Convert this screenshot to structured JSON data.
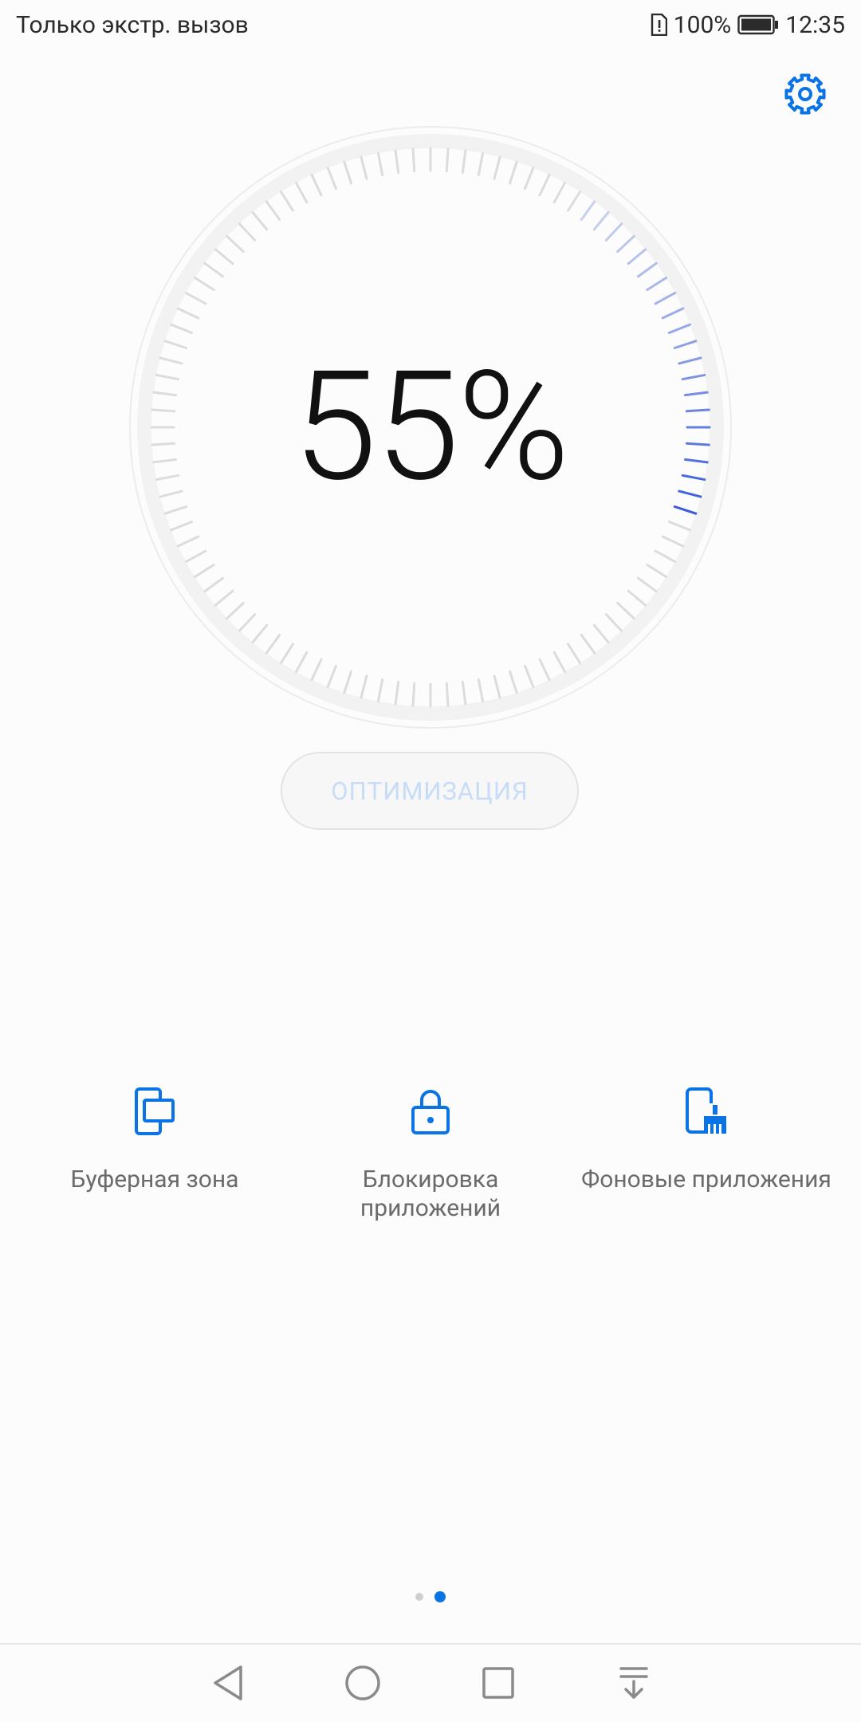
{
  "status_bar": {
    "carrier_text": "Только экстр. вызов",
    "battery_percent": "100%",
    "time": "12:35"
  },
  "gauge": {
    "value_text": "55%",
    "value": 55,
    "accent_color": "#3a5bd9"
  },
  "actions": {
    "optimize_label": "ОПТИМИЗАЦИЯ"
  },
  "shortcuts": [
    {
      "label": "Буферная зона",
      "icon": "buffer-zone-icon"
    },
    {
      "label": "Блокировка приложений",
      "icon": "lock-icon"
    },
    {
      "label": "Фоновые приложения",
      "icon": "cleanup-brush-icon"
    }
  ],
  "pager": {
    "pages": 2,
    "current": 2
  },
  "colors": {
    "accent": "#0a74e6",
    "text_secondary": "#6b6b6b"
  }
}
